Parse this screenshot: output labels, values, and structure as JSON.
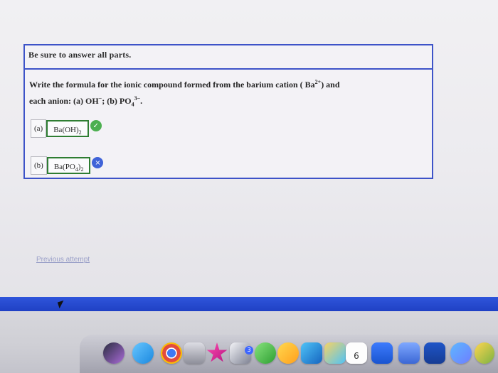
{
  "question": {
    "instruction": "Be sure to answer all parts.",
    "prompt_line1_prefix": "Write the formula for the ionic compound formed from the barium cation ( Ba",
    "prompt_line1_superscript": "2+",
    "prompt_line1_suffix": ") and",
    "prompt_line2_prefix": "each anion: (a) OH",
    "prompt_line2_superscript1": "−",
    "prompt_line2_middle": "; (b) PO",
    "prompt_line2_subscript": "4",
    "prompt_line2_superscript2": "3−",
    "prompt_line2_suffix": "."
  },
  "answers": {
    "a": {
      "label": "(a)",
      "value_main": "Ba(OH)",
      "value_sub": "2",
      "status_symbol": "✓"
    },
    "b": {
      "label": "(b)",
      "value_main": "Ba(PO",
      "value_sub1": "4",
      "value_mid": ")",
      "value_sub2": "2",
      "status_symbol": "×"
    }
  },
  "previous_attempt": "Previous attempt",
  "dock": {
    "badge_3": "3",
    "calendar_day": "6"
  },
  "colors": {
    "accent_blue": "#3d53c8",
    "correct_green": "#4caf50",
    "incorrect_blue": "#3f63d8"
  }
}
